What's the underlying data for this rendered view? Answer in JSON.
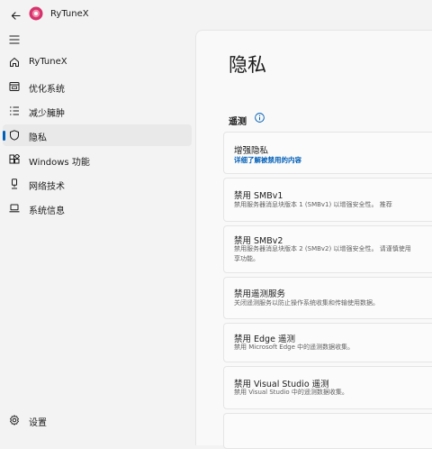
{
  "app": {
    "title": "RyTuneX"
  },
  "nav": {
    "items": [
      {
        "label": "RyTuneX",
        "icon": "home-icon"
      },
      {
        "label": "优化系统",
        "icon": "optimize-icon"
      },
      {
        "label": "减少臃肿",
        "icon": "list-icon"
      },
      {
        "label": "隐私",
        "icon": "shield-icon",
        "selected": true
      },
      {
        "label": "Windows 功能",
        "icon": "windows-features-icon"
      },
      {
        "label": "网络技术",
        "icon": "network-icon"
      },
      {
        "label": "系统信息",
        "icon": "laptop-icon"
      }
    ],
    "settings_label": "设置"
  },
  "page": {
    "title": "隐私",
    "section": "遥测",
    "cards": [
      {
        "title": "增强隐私",
        "link": "详细了解被禁用的内容"
      },
      {
        "title": "禁用 SMBv1",
        "desc": [
          "禁用服务器消息块版本 1 (SMBv1) 以增强安全性。 推荐"
        ]
      },
      {
        "title": "禁用 SMBv2",
        "desc": [
          "禁用服务器消息块版本 2 (SMBv2) 以增强安全性。 请谨慎使用",
          "享功能。"
        ]
      },
      {
        "title": "禁用遥测服务",
        "desc": [
          "关闭遥测服务以防止操作系统收集和传输使用数据。"
        ]
      },
      {
        "title": "禁用 Edge 遥测",
        "desc": [
          "禁用 Microsoft Edge 中的遥测数据收集。"
        ]
      },
      {
        "title": "禁用 Visual Studio 遥测",
        "desc": [
          "禁用 Visual Studio 中的遥测数据收集。"
        ]
      }
    ]
  },
  "colors": {
    "accent": "#005fb8",
    "logo": "#d6336c"
  }
}
